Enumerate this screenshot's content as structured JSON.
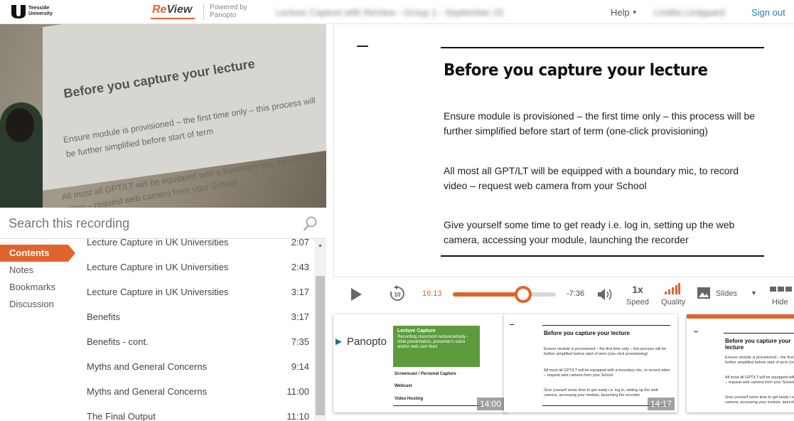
{
  "header": {
    "university_name": "Teesside University",
    "brand_re": "Re",
    "brand_view": "View",
    "powered_by": "Powered by",
    "powered_by_vendor": "Panopto",
    "session_title_obscured": "Lecture Capture with ReView - Group 1 - September 15",
    "help_label": "Help",
    "user_name_obscured": "Lindita Lindgaard",
    "signout_label": "Sign out"
  },
  "video": {
    "projected_title": "Before you capture your lecture",
    "projected_line1": "Ensure module is provisioned – the first time only – this process will",
    "projected_line2": "be further simplified before start of term",
    "projected_line3": "All most all GPT/LT will be equipped with a boundary mic, to record",
    "projected_line4": "video – request web camera from your School"
  },
  "search": {
    "placeholder": "Search this recording"
  },
  "tabs": [
    {
      "label": "Contents",
      "active": true
    },
    {
      "label": "Notes",
      "active": false
    },
    {
      "label": "Bookmarks",
      "active": false
    },
    {
      "label": "Discussion",
      "active": false
    }
  ],
  "contents": [
    {
      "title": "Lecture Capture in UK Universities",
      "time": "2:07"
    },
    {
      "title": "Lecture Capture in UK Universities",
      "time": "2:43"
    },
    {
      "title": "Lecture Capture in UK Universities",
      "time": "3:17"
    },
    {
      "title": "Benefits",
      "time": "3:17"
    },
    {
      "title": "Benefits - cont.",
      "time": "7:35"
    },
    {
      "title": "Myths and General Concerns",
      "time": "9:14"
    },
    {
      "title": "Myths and General Concerns",
      "time": "11:00"
    },
    {
      "title": "The Final Output",
      "time": "11:10"
    }
  ],
  "slide": {
    "title": "Before you capture your lecture",
    "para1": "Ensure module is provisioned – the first time only – this process will be further simplified before start of term (one-click provisioning)",
    "para2": "All most all GPT/LT will be equipped with a boundary mic, to record video – request web camera from your School",
    "para3": "Give yourself some time to get ready i.e. log in, setting up the web camera, accessing your module, launching the recorder"
  },
  "player": {
    "rewind_seconds": "10",
    "current_time": "16:13",
    "remaining_time": "-7:36",
    "progress_fraction": 0.68,
    "speed_value": "1x",
    "speed_label": "Speed",
    "quality_label": "Quality",
    "slides_label": "Slides",
    "hide_label": "Hide",
    "accent_color": "#e1642c"
  },
  "thumbnails": [
    {
      "duration": "14:00",
      "logo_text": "Panopto",
      "box_title": "Lecture Capture",
      "box_desc": "Recording classroom lecture/activity - slide presentation, presenter's voice and/or web cam feed",
      "item1": "Screencast / Personal Capture",
      "item2": "Webcast",
      "item3": "Video Hosting"
    },
    {
      "duration": "14:17",
      "title": "Before you capture your lecture",
      "p1": "Ensure module is provisioned – the first time only – this process will be further simplified before start of term (one-click provisioning)",
      "p2": "All most all GPT/LT will be equipped with a boundary mic, to record video – request web camera from your School",
      "p3": "Give yourself some time to get ready i.e. log in, setting up the web camera, accessing your module, launching the recorder"
    },
    {
      "title": "Before you capture your lecture",
      "p1": "Ensure module is provisioned – the first time only – this process will be further simplified before start of term (one-click provisioning)",
      "p2": "All most all GPT/LT will be equipped with a boundary mic, to record video – request web camera from your School",
      "p3": "Give yourself some time to get ready i.e. log in, setting up the web camera, accessing your module, launching the recorder"
    }
  ]
}
